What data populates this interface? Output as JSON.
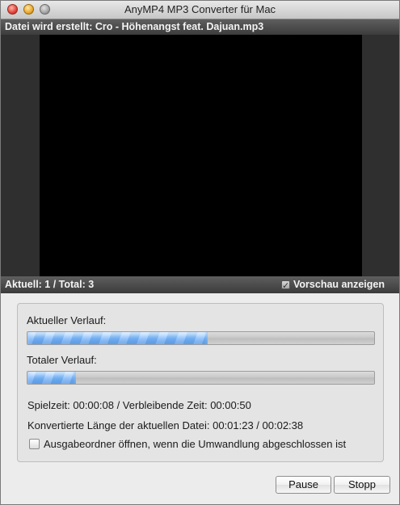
{
  "window": {
    "title": "AnyMP4 MP3 Converter für Mac"
  },
  "status_top": {
    "text": "Datei wird erstellt: Cro - Höhenangst feat. Dajuan.mp3"
  },
  "status_bottom": {
    "count_text": "Aktuell: 1 / Total: 3",
    "preview_label": "Vorschau anzeigen",
    "preview_checked": true
  },
  "progress": {
    "current_label": "Aktueller Verlauf:",
    "current_percent": 52,
    "total_label": "Totaler Verlauf:",
    "total_percent": 14,
    "time_text": "Spielzeit: 00:00:08 / Verbleibende Zeit: 00:00:50",
    "length_text": "Konvertierte Länge der aktuellen Datei: 00:01:23 / 00:02:38",
    "open_folder_label": "Ausgabeordner öffnen, wenn die Umwandlung abgeschlossen ist",
    "open_folder_checked": false
  },
  "buttons": {
    "pause_label": "Pause",
    "stop_label": "Stopp"
  }
}
